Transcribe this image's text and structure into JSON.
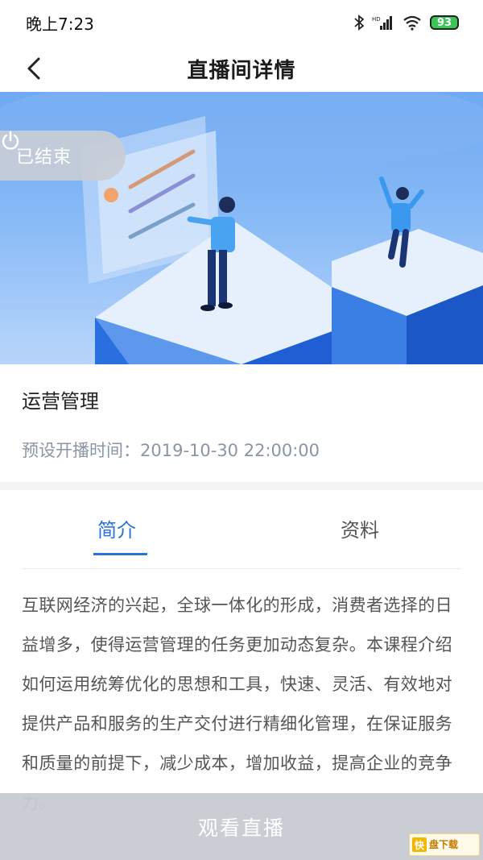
{
  "status_bar": {
    "time": "晚上7:23",
    "battery": "93"
  },
  "nav": {
    "title": "直播间详情"
  },
  "hero": {
    "status_label": "已结束"
  },
  "course": {
    "title": "运营管理",
    "scheduled_time": "预设开播时间：2019-10-30 22:00:00"
  },
  "tabs": [
    {
      "label": "简介",
      "active": true
    },
    {
      "label": "资料",
      "active": false
    }
  ],
  "description": "互联网经济的兴起，全球一体化的形成，消费者选择的日益增多，使得运营管理的任务更加动态复杂。本课程介绍如何运用统筹优化的思想和工具，快速、灵活、有效地对提供产品和服务的生产交付进行精细化管理，在保证服务和质量的前提下，减少成本，增加收益，提高企业的竞争力。",
  "actions": {
    "watch_label": "观看直播"
  },
  "watermark": {
    "logo_char": "快",
    "text": "盘下载"
  },
  "colors": {
    "accent": "#2a73d8",
    "hero_blue": "#6fa9f2",
    "button_disabled": "#c8ccd2"
  }
}
